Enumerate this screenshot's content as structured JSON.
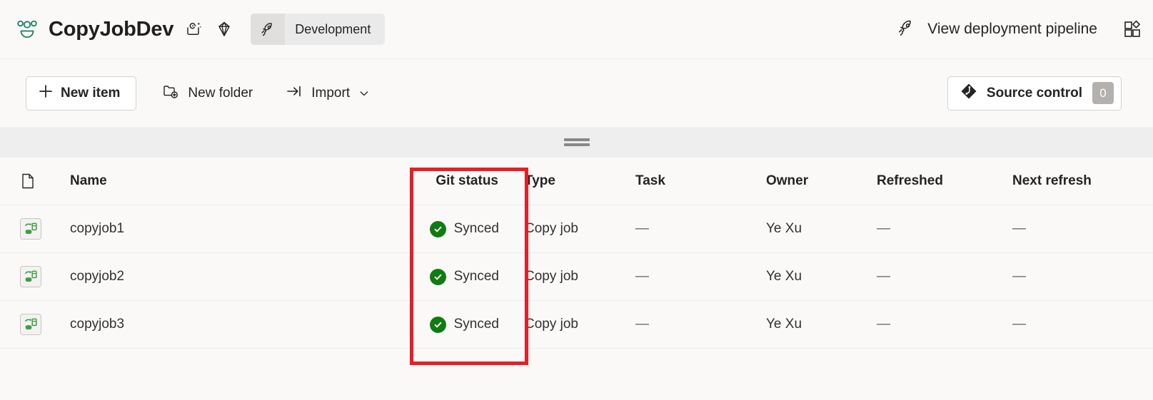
{
  "header": {
    "workspace_icon": "workspace-people-icon",
    "workspace_title": "CopyJobDev",
    "icons": [
      {
        "name": "ai-sparkle-icon"
      },
      {
        "name": "diamond-premium-icon"
      }
    ],
    "branch": {
      "icon": "rocket-icon",
      "label": "Development"
    },
    "deployment_pipeline": {
      "icon": "rocket-icon",
      "label": "View deployment pipeline"
    },
    "apps_icon": "apps-add-icon"
  },
  "toolbar": {
    "new_item": {
      "icon": "plus-icon",
      "label": "New item"
    },
    "new_folder": {
      "icon": "folder-add-icon",
      "label": "New folder"
    },
    "import": {
      "icon": "import-arrow-icon",
      "label": "Import",
      "chevron": "chevron-down-icon"
    },
    "source_control": {
      "icon": "git-branch-icon",
      "label": "Source control",
      "count": "0"
    }
  },
  "splitter": {
    "handle": "drag-handle-icon"
  },
  "table": {
    "columns": [
      {
        "key": "icon",
        "label": "",
        "icon": "document-icon"
      },
      {
        "key": "name",
        "label": "Name"
      },
      {
        "key": "git",
        "label": "Git status"
      },
      {
        "key": "type",
        "label": "Type"
      },
      {
        "key": "task",
        "label": "Task"
      },
      {
        "key": "owner",
        "label": "Owner"
      },
      {
        "key": "refreshed",
        "label": "Refreshed"
      },
      {
        "key": "next",
        "label": "Next refresh"
      }
    ],
    "rows": [
      {
        "icon": "copy-job-icon",
        "name": "copyjob1",
        "git_status": "Synced",
        "git_status_color": "#107c10",
        "type": "Copy job",
        "task": "—",
        "owner": "Ye Xu",
        "refreshed": "—",
        "next_refresh": "—"
      },
      {
        "icon": "copy-job-icon",
        "name": "copyjob2",
        "git_status": "Synced",
        "git_status_color": "#107c10",
        "type": "Copy job",
        "task": "—",
        "owner": "Ye Xu",
        "refreshed": "—",
        "next_refresh": "—"
      },
      {
        "icon": "copy-job-icon",
        "name": "copyjob3",
        "git_status": "Synced",
        "git_status_color": "#107c10",
        "type": "Copy job",
        "task": "—",
        "owner": "Ye Xu",
        "refreshed": "—",
        "next_refresh": "—"
      }
    ]
  },
  "annotation": {
    "type": "highlight-rectangle",
    "color": "#ec1c24",
    "target": "git-status-column"
  },
  "colors": {
    "page_background": "#faf9f8",
    "splitter_background": "#efeeee",
    "row_divider": "#edebe9",
    "success_green": "#107c10",
    "annotation_red": "#ec1c24",
    "badge_gray": "#b3b0ad"
  }
}
